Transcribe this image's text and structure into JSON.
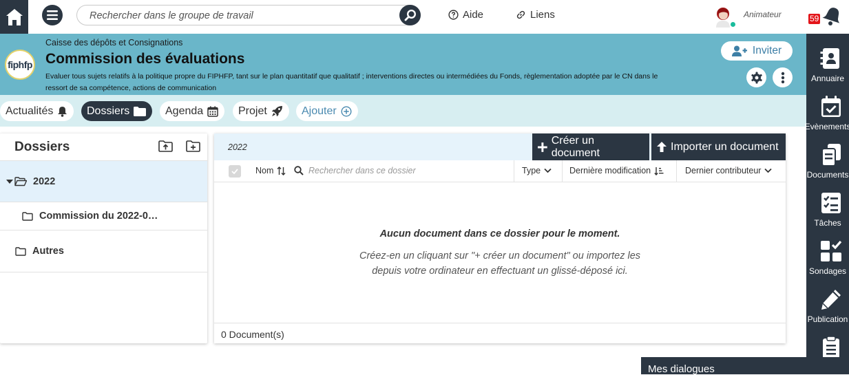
{
  "topbar": {
    "search_placeholder": "Rechercher dans le groupe de travail",
    "help_label": "Aide",
    "links_label": "Liens",
    "user_role": "Animateur",
    "notification_count": "59"
  },
  "group": {
    "organization": "Caisse des dépôts et Consignations",
    "title": "Commission des évaluations",
    "description": "Evaluer tous sujets relatifs à la politique propre du FIPHFP, tant sur le plan quantitatif que qualitatif ; interventions directes ou intermédiées du Fonds, règlementation adoptée par le CN dans le ressort de sa compétence, actions de communication",
    "logo_text": "fiphfp",
    "invite_label": "Inviter"
  },
  "tabs": [
    {
      "label": "Actualités",
      "icon": "bell-icon",
      "active": false
    },
    {
      "label": "Dossiers",
      "icon": "folder-icon",
      "active": true
    },
    {
      "label": "Agenda",
      "icon": "calendar-icon",
      "active": false
    },
    {
      "label": "Projet",
      "icon": "rocket-icon",
      "active": false
    },
    {
      "label": "Ajouter",
      "icon": "plus-circle-icon",
      "active": false
    }
  ],
  "folders_panel": {
    "title": "Dossiers",
    "items": [
      {
        "label": "2022",
        "open": true,
        "selected": true
      },
      {
        "label": "Commission du 2022-0…",
        "level": 1
      },
      {
        "label": "Autres"
      }
    ]
  },
  "documents": {
    "breadcrumb": "2022",
    "create_label": "Créer un document",
    "import_label": "Importer un document",
    "columns": {
      "name": "Nom",
      "search_placeholder": "Rechercher dans ce dossier",
      "type": "Type",
      "modified": "Dernière modification",
      "contributor": "Dernier contributeur"
    },
    "empty_title": "Aucun document dans ce dossier pour le moment.",
    "empty_text": "Créez-en un cliquant sur \"+ créer un document\" ou importez les depuis votre ordinateur en effectuant un glissé-déposé ici.",
    "count_label": "0 Document(s)"
  },
  "right_sidebar": [
    {
      "label": "Annuaire",
      "icon": "address-book-icon"
    },
    {
      "label": "Evènements",
      "icon": "calendar-check-icon"
    },
    {
      "label": "Documents",
      "icon": "documents-icon"
    },
    {
      "label": "Tâches",
      "icon": "tasks-icon"
    },
    {
      "label": "Sondages",
      "icon": "polls-icon"
    },
    {
      "label": "Publication",
      "icon": "pencil-icon"
    }
  ],
  "chat": {
    "label": "Mes dialogues"
  },
  "colors": {
    "dark": "#2b3642",
    "header": "#6ab6c9",
    "tabsbar": "#d7eef1",
    "accent": "#4a8ab0",
    "badge": "#e3151a"
  }
}
